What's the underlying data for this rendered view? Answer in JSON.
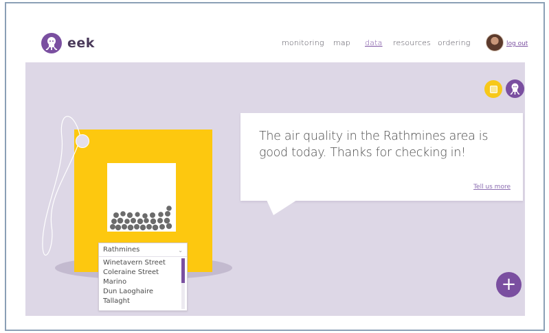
{
  "app": {
    "name": "eek",
    "logo_icon": "octopus-logo-icon"
  },
  "nav": {
    "items": [
      {
        "label": "monitoring",
        "active": false
      },
      {
        "label": "map",
        "active": false
      },
      {
        "label": "data",
        "active": true
      },
      {
        "label": "resources",
        "active": false
      },
      {
        "label": "ordering",
        "active": false
      }
    ],
    "logout_label": "log out",
    "avatar_icon": "user-avatar"
  },
  "actions": {
    "note_icon": "sticky-note-icon",
    "mascot_icon": "octopus-icon",
    "add_icon": "+"
  },
  "message": {
    "text": "The air quality in the Rathmines area is good today. Thanks for checking in!",
    "link_label": "Tell us more"
  },
  "location_select": {
    "selected": "Rathmines",
    "options": [
      "Winetavern Street",
      "Coleraine Street",
      "Marino",
      "Dun Laoghaire",
      "Tallaght"
    ]
  },
  "colors": {
    "accent": "#7a4fa0",
    "panel": "#ddd7e6",
    "tag": "#fdc80f",
    "particles": "#6b6b6b"
  }
}
